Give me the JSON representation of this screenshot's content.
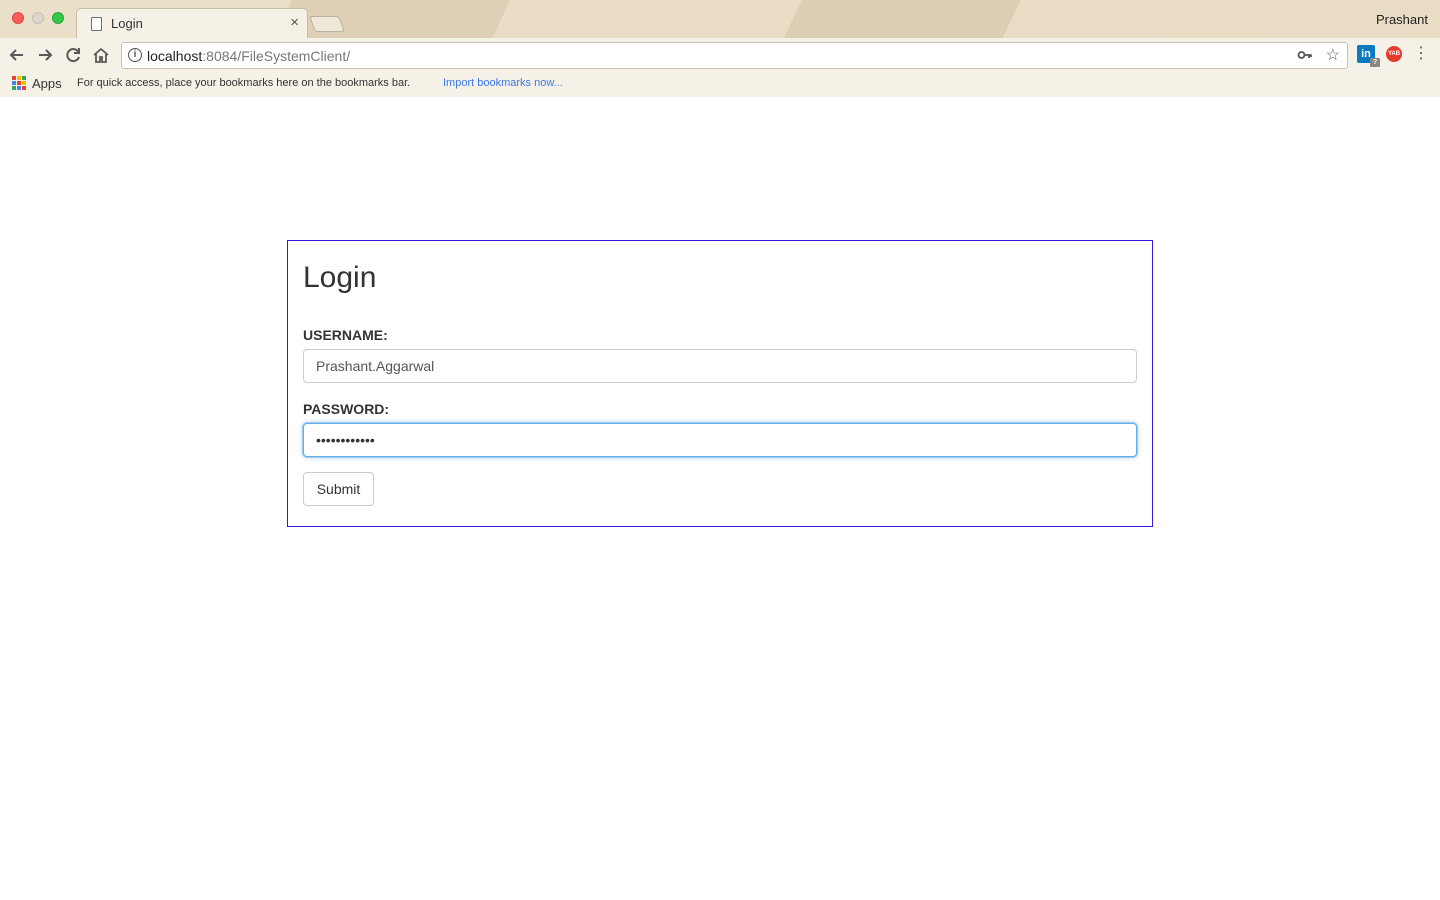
{
  "browser": {
    "tab_title": "Login",
    "tab_close": "×",
    "profile_name": "Prashant",
    "url_host": "localhost",
    "url_rest": ":8084/FileSystemClient/",
    "apps_label": "Apps",
    "bookmarks_hint": "For quick access, place your bookmarks here on the bookmarks bar.",
    "bookmarks_import": "Import bookmarks now...",
    "linkedin_ext_label": "in",
    "linkedin_ext_badge": "?",
    "yab_ext_label": "YAB",
    "icons": {
      "back": "back-arrow-icon",
      "forward": "forward-arrow-icon",
      "reload": "reload-icon",
      "home": "home-icon",
      "info": "info-icon",
      "key": "key-icon",
      "star": "star-icon",
      "menu": "kebab-menu-icon"
    }
  },
  "login": {
    "title": "Login",
    "username_label": "USERNAME:",
    "username_value": "Prashant.Aggarwal",
    "password_label": "PASSWORD:",
    "password_value": "••••••••••••",
    "submit_label": "Submit"
  },
  "colors": {
    "box_border": "#3b16d6",
    "focus_ring": "#66afe9",
    "link_blue": "#3b78e7"
  }
}
